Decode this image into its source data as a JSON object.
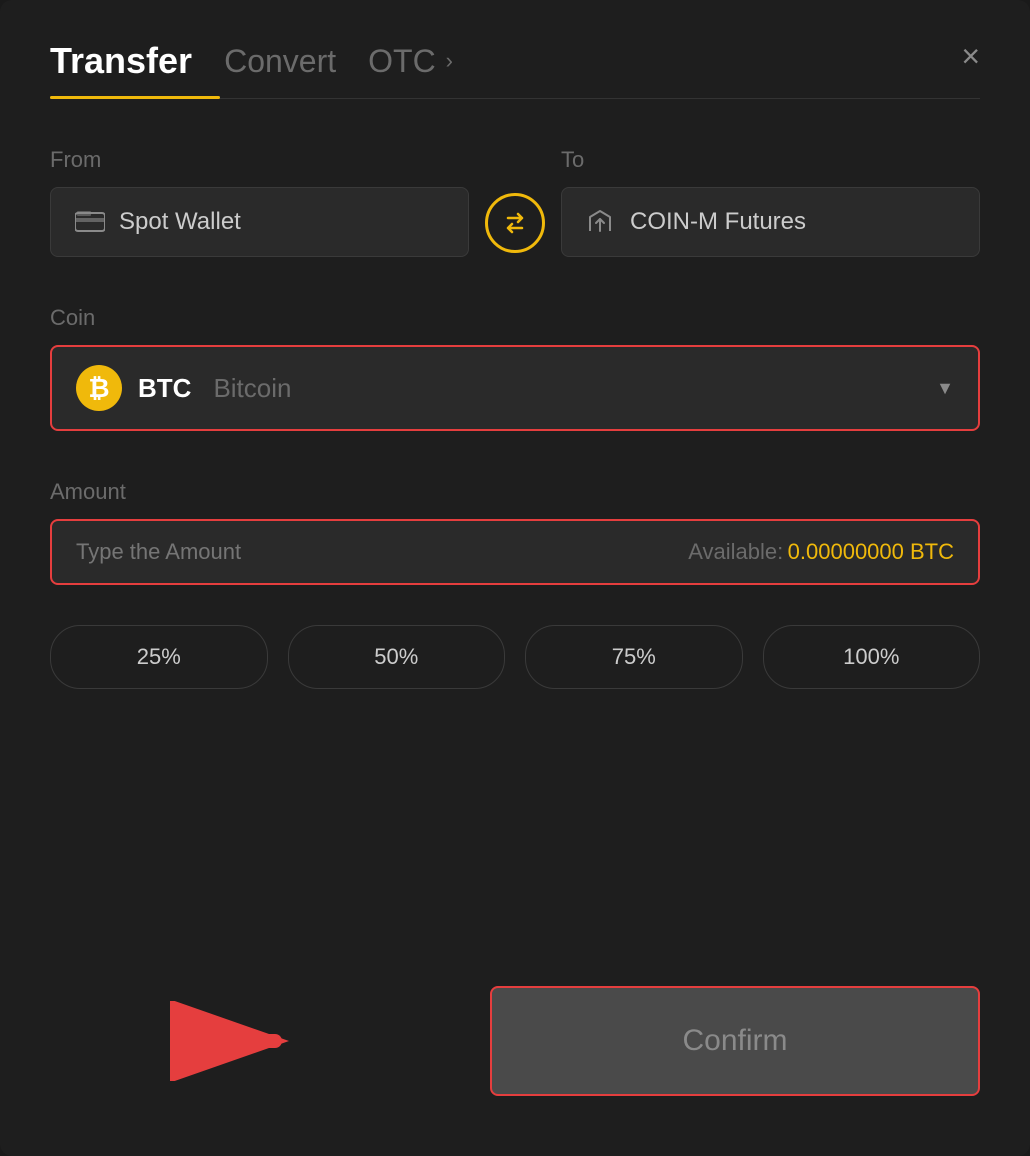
{
  "header": {
    "title": "Transfer",
    "tabs": [
      {
        "label": "Transfer",
        "active": true
      },
      {
        "label": "Convert",
        "active": false
      },
      {
        "label": "OTC",
        "active": false
      }
    ],
    "close_label": "×"
  },
  "from": {
    "label": "From",
    "wallet_label": "Spot Wallet"
  },
  "swap": {
    "icon": "⇄"
  },
  "to": {
    "label": "To",
    "wallet_label": "COIN-M Futures"
  },
  "coin": {
    "label": "Coin",
    "symbol": "BTC",
    "name": "Bitcoin",
    "chevron": "▼"
  },
  "amount": {
    "label": "Amount",
    "placeholder": "Type the Amount",
    "available_label": "Available:",
    "available_value": "0.00000000 BTC"
  },
  "percent_buttons": [
    {
      "label": "25%"
    },
    {
      "label": "50%"
    },
    {
      "label": "75%"
    },
    {
      "label": "100%"
    }
  ],
  "confirm_button": {
    "label": "Confirm"
  }
}
